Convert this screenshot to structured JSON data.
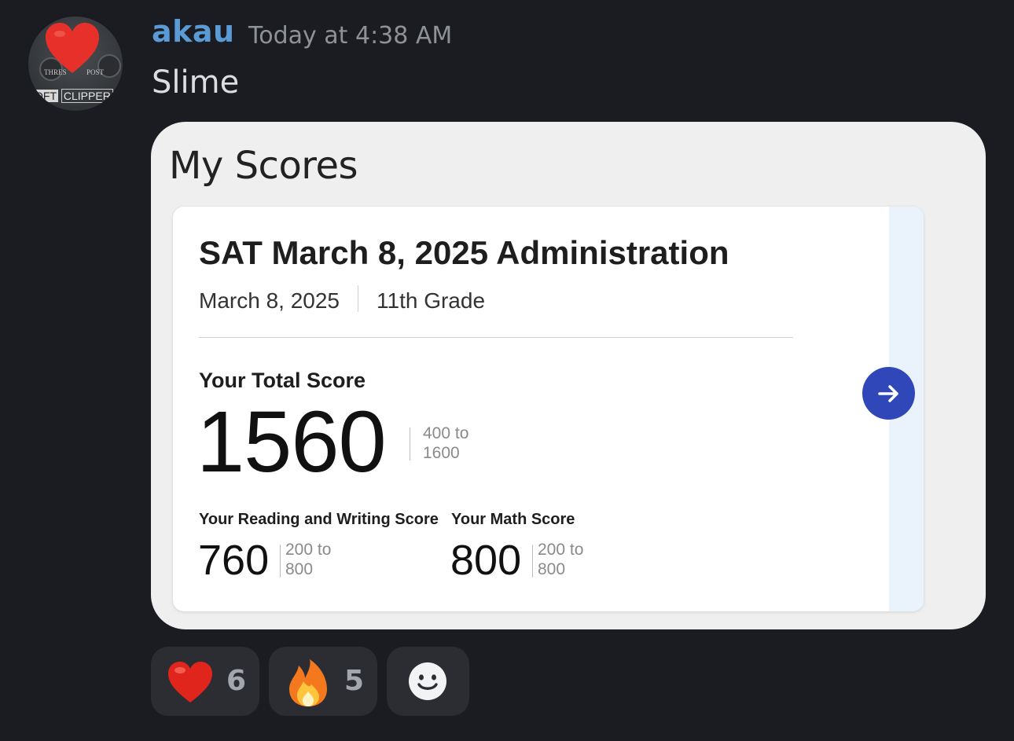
{
  "message": {
    "username": "akau",
    "timestamp": "Today at 4:38 AM",
    "text": "Slime",
    "avatar": {
      "label_left": "THRES",
      "label_right": "POST",
      "plate_left": "OFT",
      "plate_right": "CLIPPER",
      "heart_color": "#e8302a"
    }
  },
  "attachment": {
    "title": "My Scores",
    "card": {
      "heading": "SAT March 8, 2025 Administration",
      "date": "March 8, 2025",
      "grade": "11th Grade",
      "total": {
        "label": "Your Total Score",
        "score": "1560",
        "range_line1": "400 to",
        "range_line2": "1600"
      },
      "reading": {
        "label": "Your Reading and Writing Score",
        "score": "760",
        "range_line1": "200 to",
        "range_line2": "800"
      },
      "math": {
        "label": "Your Math Score",
        "score": "800",
        "range_line1": "200 to",
        "range_line2": "800"
      },
      "arrow_icon": "arrow-right-icon",
      "accent_color": "#2f47b9"
    }
  },
  "reactions": [
    {
      "emoji": "heart",
      "count": "6"
    },
    {
      "emoji": "fire",
      "count": "5"
    },
    {
      "emoji": "add-reaction"
    }
  ],
  "colors": {
    "background": "#1b1c21",
    "username": "#5b9bd5",
    "timestamp": "#8e9297",
    "reaction_bg": "#2b2d33"
  }
}
